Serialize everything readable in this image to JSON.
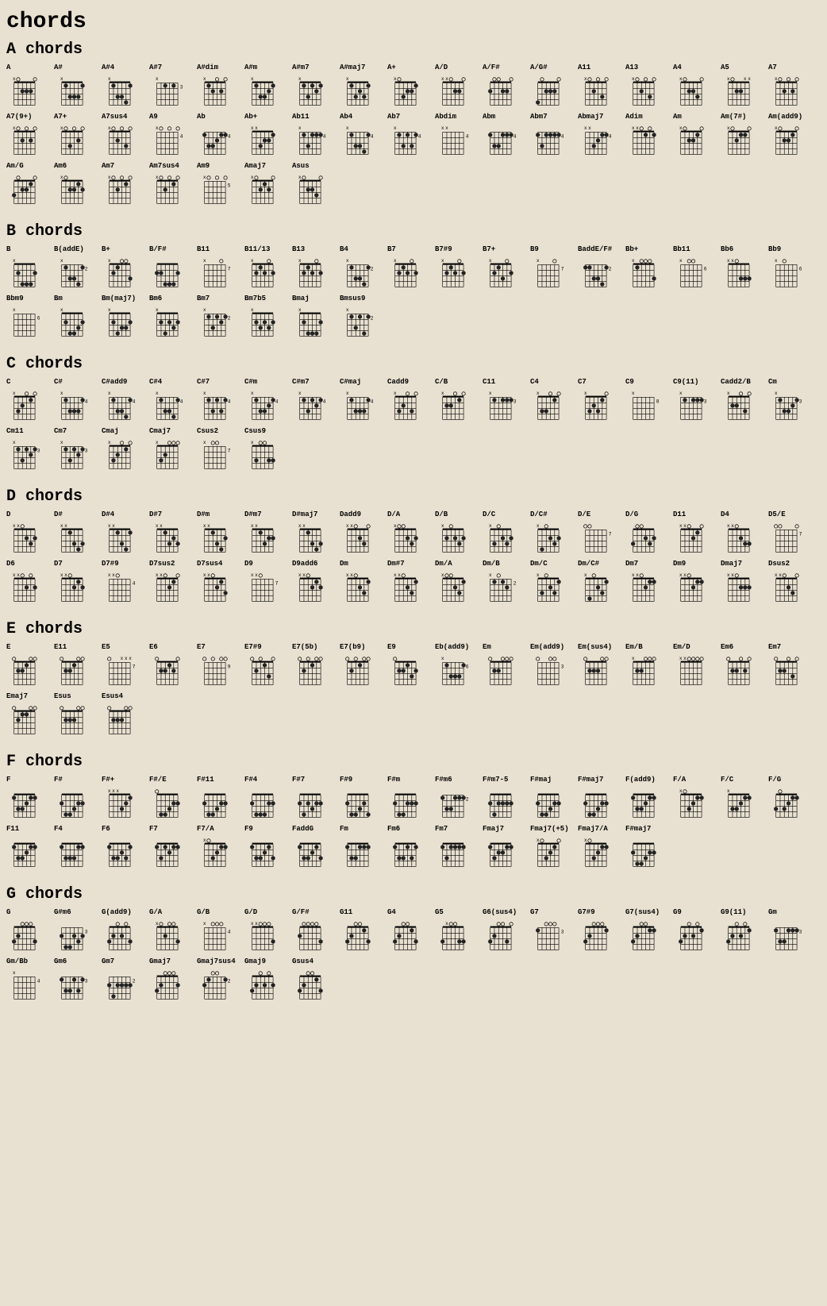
{
  "title": "chords",
  "sections": [
    {
      "id": "a",
      "title": "A chords",
      "chords": [
        {
          "name": "A",
          "strings": "x02220",
          "fret": 0
        },
        {
          "name": "A#",
          "strings": "x13331",
          "fret": 0
        },
        {
          "name": "A#4",
          "strings": "x13341",
          "fret": 0
        },
        {
          "name": "A#7",
          "strings": "x13131",
          "fret": 3
        },
        {
          "name": "A#dim",
          "strings": "x12020",
          "fret": 0
        },
        {
          "name": "A#m",
          "strings": "x13321",
          "fret": 0
        },
        {
          "name": "A#m7",
          "strings": "x13121",
          "fret": 0
        },
        {
          "name": "A#maj7",
          "strings": "x13231",
          "fret": 0
        },
        {
          "name": "A+",
          "strings": "x03221",
          "fret": 0
        },
        {
          "name": "A/D",
          "strings": "xx0220",
          "fret": 0
        },
        {
          "name": "A/F#",
          "strings": "200220",
          "fret": 0
        },
        {
          "name": "A/G#",
          "strings": "402220",
          "fret": 0
        },
        {
          "name": "A11",
          "strings": "x02030",
          "fret": 0
        },
        {
          "name": "A13",
          "strings": "x02030",
          "fret": 0
        },
        {
          "name": "A4",
          "strings": "x02230",
          "fret": 0
        },
        {
          "name": "A5",
          "strings": "x022xx",
          "fret": 0
        },
        {
          "name": "A7",
          "strings": "x02020",
          "fret": 0
        },
        {
          "name": "A7(9+)",
          "strings": "x02020",
          "fret": 0
        },
        {
          "name": "A7+",
          "strings": "x03020",
          "fret": 0
        },
        {
          "name": "A7sus4",
          "strings": "x02030",
          "fret": 0
        },
        {
          "name": "A9",
          "strings": "x02020",
          "fret": 4
        },
        {
          "name": "Ab",
          "strings": "466544",
          "fret": 0
        },
        {
          "name": "Ab+",
          "strings": "xx3221",
          "fret": 0
        },
        {
          "name": "Ab11",
          "strings": "x46444",
          "fret": 4
        },
        {
          "name": "Ab4",
          "strings": "x46674",
          "fret": 0
        },
        {
          "name": "Ab7",
          "strings": "x46464",
          "fret": 0
        },
        {
          "name": "Abdim",
          "strings": "xx2323",
          "fret": 4
        },
        {
          "name": "Abm",
          "strings": "466444",
          "fret": 0
        },
        {
          "name": "Abm7",
          "strings": "464444",
          "fret": 0
        },
        {
          "name": "Abmaj7",
          "strings": "xx6544",
          "fret": 0
        },
        {
          "name": "Adim",
          "strings": "xx0101",
          "fret": 0
        },
        {
          "name": "Am",
          "strings": "x02210",
          "fret": 0
        },
        {
          "name": "Am(7#)",
          "strings": "x02110",
          "fret": 0
        },
        {
          "name": "Am(add9)",
          "strings": "x02210",
          "fret": 0
        },
        {
          "name": "Am/G",
          "strings": "302210",
          "fret": 0
        },
        {
          "name": "Am6",
          "strings": "x02212",
          "fret": 0
        },
        {
          "name": "Am7",
          "strings": "x02010",
          "fret": 0
        },
        {
          "name": "Am7sus4",
          "strings": "x02010",
          "fret": 0
        },
        {
          "name": "Am9",
          "strings": "x02010",
          "fret": 5
        },
        {
          "name": "Amaj7",
          "strings": "x02120",
          "fret": 0
        },
        {
          "name": "Asus",
          "strings": "x02230",
          "fret": 0
        }
      ]
    },
    {
      "id": "b",
      "title": "B chords",
      "chords": [
        {
          "name": "B",
          "strings": "x24442",
          "fret": 0
        },
        {
          "name": "B(addE)",
          "strings": "x24452",
          "fret": 0
        },
        {
          "name": "B+",
          "strings": "x21003",
          "fret": 0
        },
        {
          "name": "B/F#",
          "strings": "224442",
          "fret": 0
        },
        {
          "name": "B11",
          "strings": "x21202",
          "fret": 7
        },
        {
          "name": "B11/13",
          "strings": "x21202",
          "fret": 0
        },
        {
          "name": "B13",
          "strings": "x21202",
          "fret": 0
        },
        {
          "name": "B4",
          "strings": "x24452",
          "fret": 2
        },
        {
          "name": "B7",
          "strings": "x21202",
          "fret": 0
        },
        {
          "name": "B7#9",
          "strings": "x21202",
          "fret": 0
        },
        {
          "name": "B7+",
          "strings": "x21302",
          "fret": 0
        },
        {
          "name": "B9",
          "strings": "x21202",
          "fret": 7
        },
        {
          "name": "BaddE/F#",
          "strings": "224452",
          "fret": 0
        },
        {
          "name": "Bb+",
          "strings": "x10003",
          "fret": 0
        },
        {
          "name": "Bb11",
          "strings": "x10013",
          "fret": 6
        },
        {
          "name": "Bb6",
          "strings": "xx0333",
          "fret": 0
        },
        {
          "name": "Bb9",
          "strings": "x10213",
          "fret": 6
        },
        {
          "name": "Bbm9",
          "strings": "x13121",
          "fret": 6
        },
        {
          "name": "Bm",
          "strings": "x24432",
          "fret": 0
        },
        {
          "name": "Bm(maj7)",
          "strings": "x24332",
          "fret": 0
        },
        {
          "name": "Bm6",
          "strings": "x24232",
          "fret": 0
        },
        {
          "name": "Bm7",
          "strings": "x24232",
          "fret": 2
        },
        {
          "name": "Bm7b5",
          "strings": "x23232",
          "fret": 0
        },
        {
          "name": "Bmaj",
          "strings": "x24442",
          "fret": 0
        },
        {
          "name": "Bmsus9",
          "strings": "x24252",
          "fret": 0
        }
      ]
    },
    {
      "id": "c",
      "title": "C chords",
      "chords": [
        {
          "name": "C",
          "strings": "x32010",
          "fret": 0
        },
        {
          "name": "C#",
          "strings": "x46664",
          "fret": 0
        },
        {
          "name": "C#add9",
          "strings": "x46674",
          "fret": 4
        },
        {
          "name": "C#4",
          "strings": "x46674",
          "fret": 4
        },
        {
          "name": "C#7",
          "strings": "x46464",
          "fret": 0
        },
        {
          "name": "C#m",
          "strings": "x46654",
          "fret": 0
        },
        {
          "name": "C#m7",
          "strings": "x46454",
          "fret": 0
        },
        {
          "name": "C#maj",
          "strings": "x46664",
          "fret": 0
        },
        {
          "name": "Cadd9",
          "strings": "x32030",
          "fret": 0
        },
        {
          "name": "C/B",
          "strings": "x22010",
          "fret": 0
        },
        {
          "name": "C11",
          "strings": "x32333",
          "fret": 3
        },
        {
          "name": "C4",
          "strings": "x33010",
          "fret": 0
        },
        {
          "name": "C7",
          "strings": "x32310",
          "fret": 0
        },
        {
          "name": "C9",
          "strings": "x32333",
          "fret": 8
        },
        {
          "name": "C9(11)",
          "strings": "x32333",
          "fret": 3
        },
        {
          "name": "Cadd2/B",
          "strings": "x22030",
          "fret": 0
        },
        {
          "name": "Cm",
          "strings": "x35543",
          "fret": 3
        },
        {
          "name": "Cm11",
          "strings": "x35343",
          "fret": 3
        },
        {
          "name": "Cm7",
          "strings": "x35343",
          "fret": 3
        },
        {
          "name": "Cmaj",
          "strings": "x32010",
          "fret": 0
        },
        {
          "name": "Cmaj7",
          "strings": "x32000",
          "fret": 0
        },
        {
          "name": "Csus2",
          "strings": "x30033",
          "fret": 7
        },
        {
          "name": "Csus9",
          "strings": "x30033",
          "fret": 0
        }
      ]
    },
    {
      "id": "d",
      "title": "D chords",
      "chords": [
        {
          "name": "D",
          "strings": "xx0232",
          "fret": 0
        },
        {
          "name": "D#",
          "strings": "xx1343",
          "fret": 0
        },
        {
          "name": "D#4",
          "strings": "xx1341",
          "fret": 0
        },
        {
          "name": "D#7",
          "strings": "xx1323",
          "fret": 0
        },
        {
          "name": "D#m",
          "strings": "xx1342",
          "fret": 0
        },
        {
          "name": "D#m7",
          "strings": "xx1322",
          "fret": 0
        },
        {
          "name": "D#maj7",
          "strings": "xx1343",
          "fret": 0
        },
        {
          "name": "Dadd9",
          "strings": "xx0230",
          "fret": 0
        },
        {
          "name": "D/A",
          "strings": "x00232",
          "fret": 0
        },
        {
          "name": "D/B",
          "strings": "x20232",
          "fret": 0
        },
        {
          "name": "D/C",
          "strings": "x30232",
          "fret": 0
        },
        {
          "name": "D/C#",
          "strings": "x40232",
          "fret": 0
        },
        {
          "name": "D/E",
          "strings": "002232",
          "fret": 7
        },
        {
          "name": "D/G",
          "strings": "300232",
          "fret": 0
        },
        {
          "name": "D11",
          "strings": "xx0210",
          "fret": 0
        },
        {
          "name": "D4",
          "strings": "xx0233",
          "fret": 0
        },
        {
          "name": "D5/E",
          "strings": "002230",
          "fret": 7
        },
        {
          "name": "D6",
          "strings": "xx0202",
          "fret": 0
        },
        {
          "name": "D7",
          "strings": "xx0212",
          "fret": 0
        },
        {
          "name": "D7#9",
          "strings": "xx0212",
          "fret": 4
        },
        {
          "name": "D7sus2",
          "strings": "xx0210",
          "fret": 0
        },
        {
          "name": "D7sus4",
          "strings": "xx0213",
          "fret": 0
        },
        {
          "name": "D9",
          "strings": "xx0212",
          "fret": 7
        },
        {
          "name": "D9add6",
          "strings": "xx0212",
          "fret": 0
        },
        {
          "name": "Dm",
          "strings": "xx0231",
          "fret": 0
        },
        {
          "name": "Dm#7",
          "strings": "xx0231",
          "fret": 0
        },
        {
          "name": "Dm/A",
          "strings": "x00231",
          "fret": 0
        },
        {
          "name": "Dm/B",
          "strings": "x20231",
          "fret": 2
        },
        {
          "name": "Dm/C",
          "strings": "x30231",
          "fret": 0
        },
        {
          "name": "Dm/C#",
          "strings": "x40231",
          "fret": 0
        },
        {
          "name": "Dm7",
          "strings": "xx0211",
          "fret": 0
        },
        {
          "name": "Dm9",
          "strings": "xx0211",
          "fret": 0
        },
        {
          "name": "Dmaj7",
          "strings": "xx0222",
          "fret": 0
        },
        {
          "name": "Dsus2",
          "strings": "xx0230",
          "fret": 0
        }
      ]
    },
    {
      "id": "e",
      "title": "E chords",
      "chords": [
        {
          "name": "E",
          "strings": "022100",
          "fret": 0
        },
        {
          "name": "E11",
          "strings": "022100",
          "fret": 0
        },
        {
          "name": "E5",
          "strings": "022xxx",
          "fret": 7
        },
        {
          "name": "E6",
          "strings": "022120",
          "fret": 0
        },
        {
          "name": "E7",
          "strings": "020100",
          "fret": 9
        },
        {
          "name": "E7#9",
          "strings": "020130",
          "fret": 0
        },
        {
          "name": "E7(5b)",
          "strings": "020100",
          "fret": 0
        },
        {
          "name": "E7(b9)",
          "strings": "020100",
          "fret": 0
        },
        {
          "name": "E9",
          "strings": "022132",
          "fret": 0
        },
        {
          "name": "Eb(add9)",
          "strings": "x68886",
          "fret": 0
        },
        {
          "name": "Em",
          "strings": "022000",
          "fret": 0
        },
        {
          "name": "Em(add9)",
          "strings": "022002",
          "fret": 3
        },
        {
          "name": "Em(sus4)",
          "strings": "022200",
          "fret": 0
        },
        {
          "name": "Em/B",
          "strings": "x22000",
          "fret": 0
        },
        {
          "name": "Em/D",
          "strings": "xx0000",
          "fret": 0
        },
        {
          "name": "Em6",
          "strings": "022020",
          "fret": 0
        },
        {
          "name": "Em7",
          "strings": "022030",
          "fret": 0
        },
        {
          "name": "Emaj7",
          "strings": "021100",
          "fret": 0
        },
        {
          "name": "Esus",
          "strings": "022200",
          "fret": 0
        },
        {
          "name": "Esus4",
          "strings": "022200",
          "fret": 0
        }
      ]
    },
    {
      "id": "f",
      "title": "F chords",
      "chords": [
        {
          "name": "F",
          "strings": "133211",
          "fret": 0
        },
        {
          "name": "F#",
          "strings": "244322",
          "fret": 0
        },
        {
          "name": "F#+",
          "strings": "xxx321",
          "fret": 0
        },
        {
          "name": "F#/E",
          "strings": "044322",
          "fret": 0
        },
        {
          "name": "F#11",
          "strings": "244322",
          "fret": 0
        },
        {
          "name": "F#4",
          "strings": "244422",
          "fret": 0
        },
        {
          "name": "F#7",
          "strings": "242322",
          "fret": 0
        },
        {
          "name": "F#9",
          "strings": "244324",
          "fret": 0
        },
        {
          "name": "F#m",
          "strings": "244222",
          "fret": 0
        },
        {
          "name": "F#m6",
          "strings": "244222",
          "fret": 2
        },
        {
          "name": "F#m7-5",
          "strings": "242222",
          "fret": 0
        },
        {
          "name": "F#maj",
          "strings": "244322",
          "fret": 0
        },
        {
          "name": "F#maj7",
          "strings": "244322",
          "fret": 0
        },
        {
          "name": "F(add9)",
          "strings": "133211",
          "fret": 0
        },
        {
          "name": "F/A",
          "strings": "x03211",
          "fret": 0
        },
        {
          "name": "F/C",
          "strings": "x33211",
          "fret": 0
        },
        {
          "name": "F/G",
          "strings": "303211",
          "fret": 0
        },
        {
          "name": "F11",
          "strings": "133211",
          "fret": 0
        },
        {
          "name": "F4",
          "strings": "133311",
          "fret": 0
        },
        {
          "name": "F6",
          "strings": "133231",
          "fret": 0
        },
        {
          "name": "F7",
          "strings": "131211",
          "fret": 0
        },
        {
          "name": "F7/A",
          "strings": "x03211",
          "fret": 0
        },
        {
          "name": "F9",
          "strings": "133213",
          "fret": 0
        },
        {
          "name": "FaddG",
          "strings": "133213",
          "fret": 0
        },
        {
          "name": "Fm",
          "strings": "133111",
          "fret": 0
        },
        {
          "name": "Fm6",
          "strings": "133131",
          "fret": 0
        },
        {
          "name": "Fm7",
          "strings": "131111",
          "fret": 0
        },
        {
          "name": "Fmaj7",
          "strings": "132211",
          "fret": 0
        },
        {
          "name": "Fmaj7(+5)",
          "strings": "x03210",
          "fret": 0
        },
        {
          "name": "Fmaj7/A",
          "strings": "x03211",
          "fret": 0
        },
        {
          "name": "F#maj7",
          "strings": "244322",
          "fret": 0
        }
      ]
    },
    {
      "id": "g",
      "title": "G chords",
      "chords": [
        {
          "name": "G",
          "strings": "320003",
          "fret": 0
        },
        {
          "name": "G#m6",
          "strings": "466454",
          "fret": 3
        },
        {
          "name": "G(add9)",
          "strings": "320203",
          "fret": 0
        },
        {
          "name": "G/A",
          "strings": "x02003",
          "fret": 0
        },
        {
          "name": "G/B",
          "strings": "x20003",
          "fret": 4
        },
        {
          "name": "G/D",
          "strings": "xx0003",
          "fret": 0
        },
        {
          "name": "G/F#",
          "strings": "200003",
          "fret": 0
        },
        {
          "name": "G11",
          "strings": "320013",
          "fret": 0
        },
        {
          "name": "G4",
          "strings": "320013",
          "fret": 0
        },
        {
          "name": "G5",
          "strings": "3x0033",
          "fret": 0
        },
        {
          "name": "G6(sus4)",
          "strings": "320030",
          "fret": 0
        },
        {
          "name": "G7",
          "strings": "320001",
          "fret": 3
        },
        {
          "name": "G7#9",
          "strings": "320001",
          "fret": 0
        },
        {
          "name": "G7(sus4)",
          "strings": "320011",
          "fret": 0
        },
        {
          "name": "G9",
          "strings": "320201",
          "fret": 0
        },
        {
          "name": "G9(11)",
          "strings": "320201",
          "fret": 0
        },
        {
          "name": "Gm",
          "strings": "355333",
          "fret": 3
        },
        {
          "name": "Gm/Bb",
          "strings": "x13333",
          "fret": 4
        },
        {
          "name": "Gm6",
          "strings": "355353",
          "fret": 3
        },
        {
          "name": "Gm7",
          "strings": "353333",
          "fret": 2
        },
        {
          "name": "Gmaj7",
          "strings": "320002",
          "fret": 0
        },
        {
          "name": "Gmaj7sus4",
          "strings": "320012",
          "fret": 2
        },
        {
          "name": "Gmaj9",
          "strings": "320202",
          "fret": 0
        },
        {
          "name": "Gsus4",
          "strings": "320013",
          "fret": 0
        }
      ]
    }
  ]
}
